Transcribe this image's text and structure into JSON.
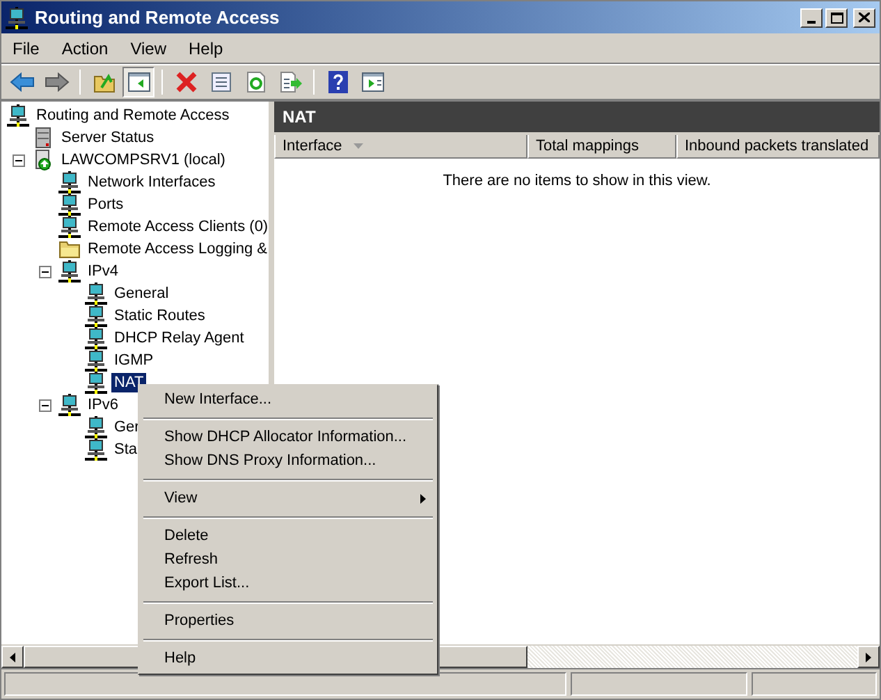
{
  "window": {
    "title": "Routing and Remote Access"
  },
  "menu": [
    {
      "label": "File"
    },
    {
      "label": "Action"
    },
    {
      "label": "View"
    },
    {
      "label": "Help"
    }
  ],
  "toolbar": [
    {
      "kind": "back",
      "pressed": false
    },
    {
      "kind": "forward",
      "pressed": false
    },
    {
      "kind": "sep"
    },
    {
      "kind": "up",
      "pressed": false
    },
    {
      "kind": "tree",
      "pressed": true
    },
    {
      "kind": "sep"
    },
    {
      "kind": "delete",
      "pressed": false
    },
    {
      "kind": "properties",
      "pressed": false
    },
    {
      "kind": "refresh",
      "pressed": false
    },
    {
      "kind": "export",
      "pressed": false
    },
    {
      "kind": "sep"
    },
    {
      "kind": "help",
      "pressed": false
    },
    {
      "kind": "action",
      "pressed": false
    }
  ],
  "tree": [
    {
      "label": "Routing and Remote Access",
      "kind": "node",
      "selected": false,
      "children": [
        {
          "label": "Server Status",
          "kind": "server",
          "selected": false
        },
        {
          "label": "LAWCOMPSRV1 (local)",
          "kind": "host",
          "selected": false,
          "expanded": true,
          "children": [
            {
              "label": "Network Interfaces",
              "kind": "node",
              "selected": false
            },
            {
              "label": "Ports",
              "kind": "node",
              "selected": false
            },
            {
              "label": "Remote Access Clients (0)",
              "kind": "node",
              "selected": false
            },
            {
              "label": "Remote Access Logging &",
              "kind": "folder",
              "selected": false
            },
            {
              "label": "IPv4",
              "kind": "node",
              "selected": false,
              "expanded": true,
              "children": [
                {
                  "label": "General",
                  "kind": "node",
                  "selected": false
                },
                {
                  "label": "Static Routes",
                  "kind": "node",
                  "selected": false
                },
                {
                  "label": "DHCP Relay Agent",
                  "kind": "node",
                  "selected": false
                },
                {
                  "label": "IGMP",
                  "kind": "node",
                  "selected": false
                },
                {
                  "label": "NAT",
                  "kind": "node",
                  "selected": true
                }
              ]
            },
            {
              "label": "IPv6",
              "kind": "node",
              "selected": false,
              "expanded": true,
              "children": [
                {
                  "label": "Ger",
                  "kind": "node",
                  "selected": false
                },
                {
                  "label": "Sta",
                  "kind": "node",
                  "selected": false
                }
              ]
            }
          ]
        }
      ]
    }
  ],
  "pane": {
    "title": "NAT",
    "columns": [
      {
        "label": "Interface",
        "sorted": true
      },
      {
        "label": "Total mappings",
        "sorted": false
      },
      {
        "label": "Inbound packets translated",
        "sorted": false
      }
    ],
    "empty_text": "There are no items to show in this view."
  },
  "context_menu": [
    {
      "kind": "item",
      "label": "New Interface..."
    },
    {
      "kind": "separator"
    },
    {
      "kind": "item",
      "label": "Show DHCP Allocator Information..."
    },
    {
      "kind": "item",
      "label": "Show DNS Proxy Information..."
    },
    {
      "kind": "separator"
    },
    {
      "kind": "submenu",
      "label": "View"
    },
    {
      "kind": "separator"
    },
    {
      "kind": "item",
      "label": "Delete"
    },
    {
      "kind": "item",
      "label": "Refresh"
    },
    {
      "kind": "item",
      "label": "Export List..."
    },
    {
      "kind": "separator"
    },
    {
      "kind": "item",
      "label": "Properties"
    },
    {
      "kind": "separator"
    },
    {
      "kind": "item",
      "label": "Help"
    }
  ]
}
